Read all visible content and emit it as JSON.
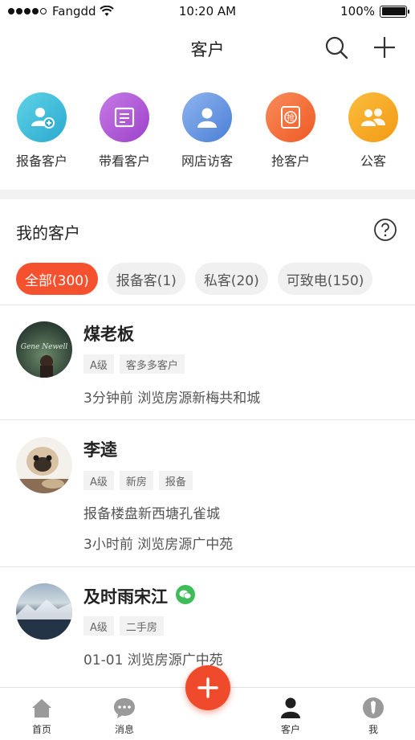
{
  "status_bar": {
    "carrier": "Fangdd",
    "time": "10:20 AM",
    "battery": "100%"
  },
  "nav": {
    "title": "客户"
  },
  "quick_actions": [
    {
      "label": "报备客户",
      "color": "#3bbfd9",
      "icon": "add-person-icon"
    },
    {
      "label": "带看客户",
      "color": "#b15bd6",
      "icon": "document-icon"
    },
    {
      "label": "网店访客",
      "color": "#5b8ee0",
      "icon": "person-icon"
    },
    {
      "label": "抢客户",
      "color": "#f26a34",
      "icon": "grab-icon"
    },
    {
      "label": "公客",
      "color": "#f5a623",
      "icon": "group-icon"
    }
  ],
  "section": {
    "title": "我的客户"
  },
  "filters": [
    {
      "label": "全部(300)",
      "active": true
    },
    {
      "label": "报备客(1)",
      "active": false
    },
    {
      "label": "私客(20)",
      "active": false
    },
    {
      "label": "可致电(150)",
      "active": false
    }
  ],
  "customers": [
    {
      "name": "煤老板",
      "tags": [
        "A级",
        "客多多客户"
      ],
      "lines": [
        "3分钟前 浏览房源新梅共和城"
      ],
      "wechat": false
    },
    {
      "name": "李逵",
      "tags": [
        "A级",
        "新房",
        "报备"
      ],
      "lines": [
        "报备楼盘新西塘孔雀城",
        "3小时前 浏览房源广中苑"
      ],
      "wechat": false
    },
    {
      "name": "及时雨宋江",
      "tags": [
        "A级",
        "二手房"
      ],
      "lines": [
        "01-01 浏览房源广中苑"
      ],
      "wechat": true
    }
  ],
  "tabs": [
    {
      "label": "首页",
      "icon": "home-icon"
    },
    {
      "label": "消息",
      "icon": "message-icon"
    },
    {
      "label": "",
      "icon": "plus-icon"
    },
    {
      "label": "客户",
      "icon": "customer-icon"
    },
    {
      "label": "我",
      "icon": "me-icon"
    }
  ],
  "colors": {
    "accent": "#f5512e"
  }
}
